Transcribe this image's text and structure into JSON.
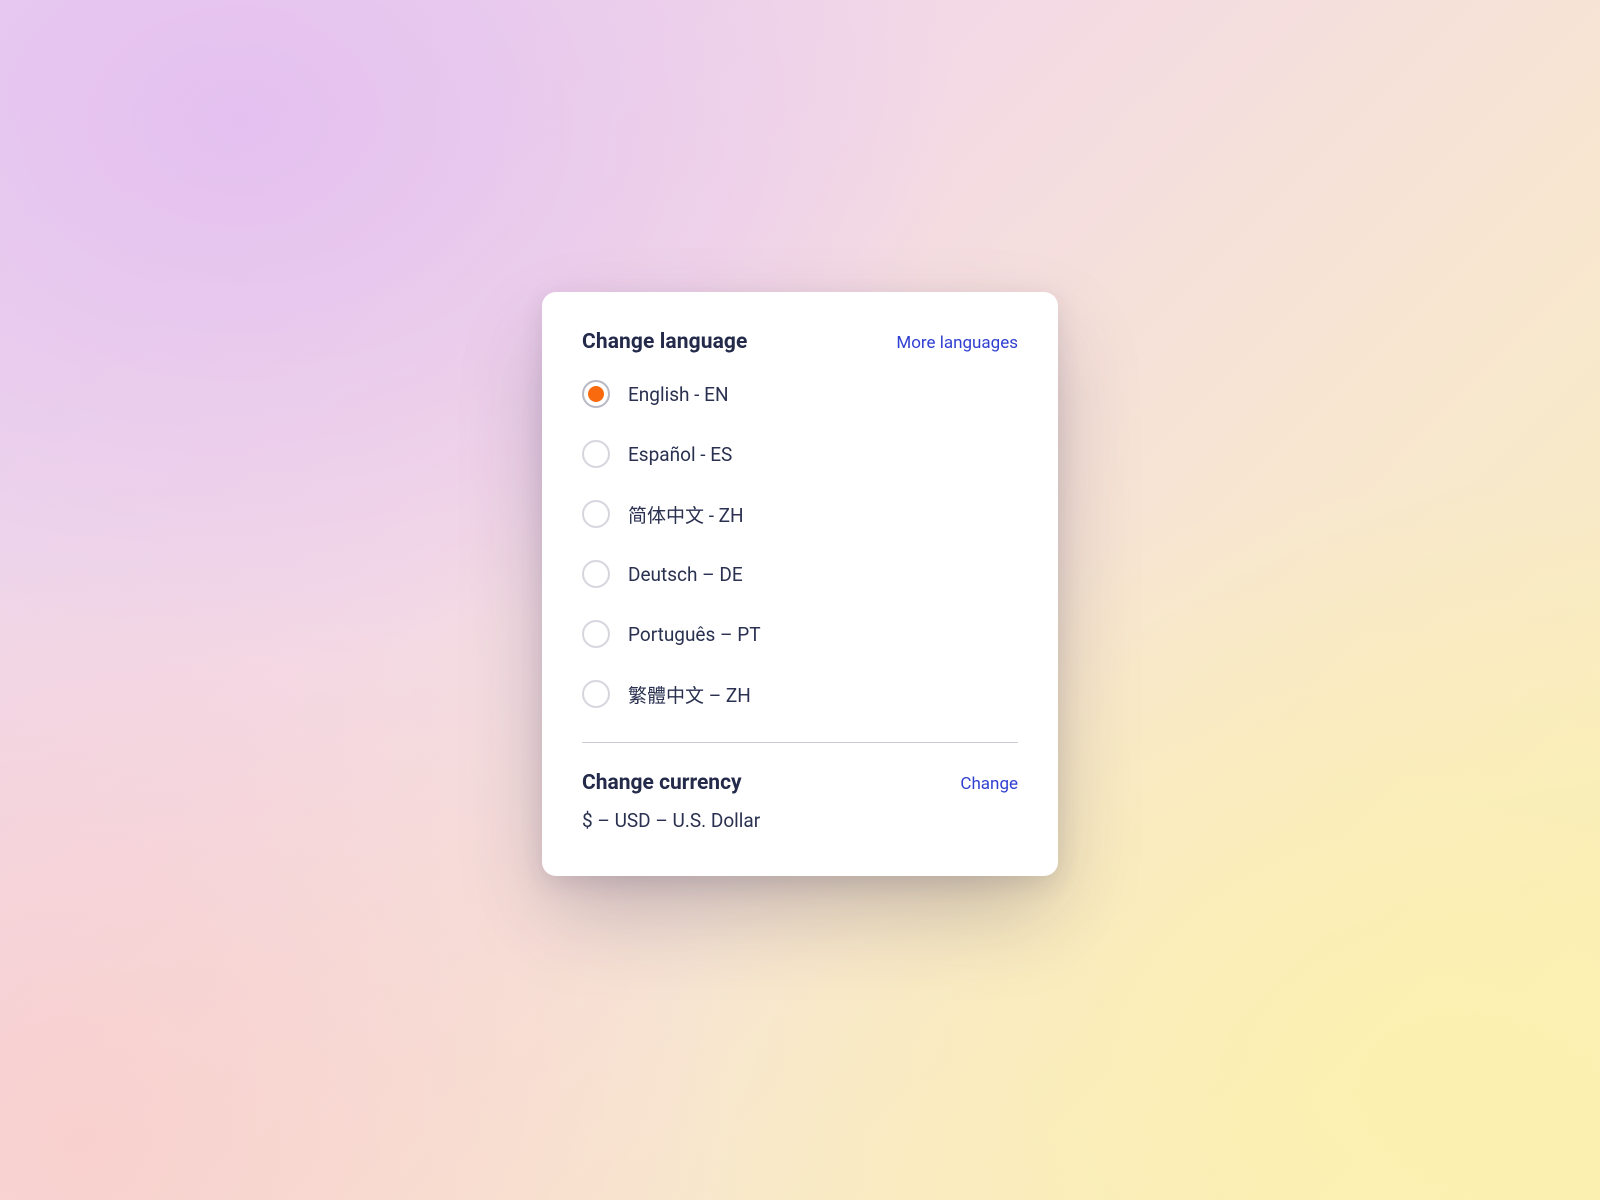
{
  "colors": {
    "accent_orange": "#f96a0f",
    "link_blue": "#2f3fd1",
    "text_dark": "#232a4a"
  },
  "language_section": {
    "title": "Change language",
    "more_link": "More languages",
    "selected_index": 0,
    "options": [
      {
        "label": "English - EN"
      },
      {
        "label": "Español - ES"
      },
      {
        "label": "简体中文 - ZH"
      },
      {
        "label": "Deutsch – DE"
      },
      {
        "label": "Português – PT"
      },
      {
        "label": "繁體中文 – ZH"
      }
    ]
  },
  "currency_section": {
    "title": "Change currency",
    "change_link": "Change",
    "current": "$ – USD – U.S. Dollar"
  }
}
